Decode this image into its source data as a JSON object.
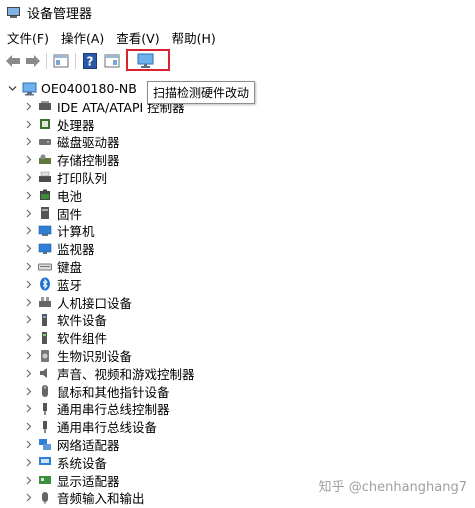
{
  "window": {
    "title": "设备管理器"
  },
  "menu": [
    "文件(F)",
    "操作(A)",
    "查看(V)",
    "帮助(H)"
  ],
  "tooltip": "扫描检测硬件改动",
  "tree": {
    "root": "OE0400180-NB",
    "items": [
      {
        "label": "IDE ATA/ATAPI 控制器",
        "icon": "ide-controller-icon",
        "color": "#5a5a5a"
      },
      {
        "label": "处理器",
        "icon": "processor-icon",
        "color": "#3b6e2f"
      },
      {
        "label": "磁盘驱动器",
        "icon": "disk-drive-icon",
        "color": "#6f6f6f"
      },
      {
        "label": "存储控制器",
        "icon": "storage-controller-icon",
        "color": "#5d7a3a"
      },
      {
        "label": "打印队列",
        "icon": "printer-icon",
        "color": "#4a4a4a"
      },
      {
        "label": "电池",
        "icon": "battery-icon",
        "color": "#3d8b3d"
      },
      {
        "label": "固件",
        "icon": "firmware-icon",
        "color": "#555555"
      },
      {
        "label": "计算机",
        "icon": "computer-icon",
        "color": "#2f7fd6"
      },
      {
        "label": "监视器",
        "icon": "monitor-icon",
        "color": "#2f7fd6"
      },
      {
        "label": "键盘",
        "icon": "keyboard-icon",
        "color": "#777777"
      },
      {
        "label": "蓝牙",
        "icon": "bluetooth-icon",
        "color": "#1d6fd1"
      },
      {
        "label": "人机接口设备",
        "icon": "hid-icon",
        "color": "#666666"
      },
      {
        "label": "软件设备",
        "icon": "software-device-icon",
        "color": "#555555"
      },
      {
        "label": "软件组件",
        "icon": "software-component-icon",
        "color": "#555555"
      },
      {
        "label": "生物识别设备",
        "icon": "biometric-icon",
        "color": "#777777"
      },
      {
        "label": "声音、视频和游戏控制器",
        "icon": "sound-icon",
        "color": "#666666"
      },
      {
        "label": "鼠标和其他指针设备",
        "icon": "mouse-icon",
        "color": "#666666"
      },
      {
        "label": "通用串行总线控制器",
        "icon": "usb-controller-icon",
        "color": "#555555"
      },
      {
        "label": "通用串行总线设备",
        "icon": "usb-device-icon",
        "color": "#555555"
      },
      {
        "label": "网络适配器",
        "icon": "network-adapter-icon",
        "color": "#2f7fd6"
      },
      {
        "label": "系统设备",
        "icon": "system-device-icon",
        "color": "#2f7fd6"
      },
      {
        "label": "显示适配器",
        "icon": "display-adapter-icon",
        "color": "#3c8f3c"
      },
      {
        "label": "音频输入和输出",
        "icon": "audio-io-icon",
        "color": "#666666"
      }
    ]
  },
  "watermark": "知乎 @chenhanghang7"
}
